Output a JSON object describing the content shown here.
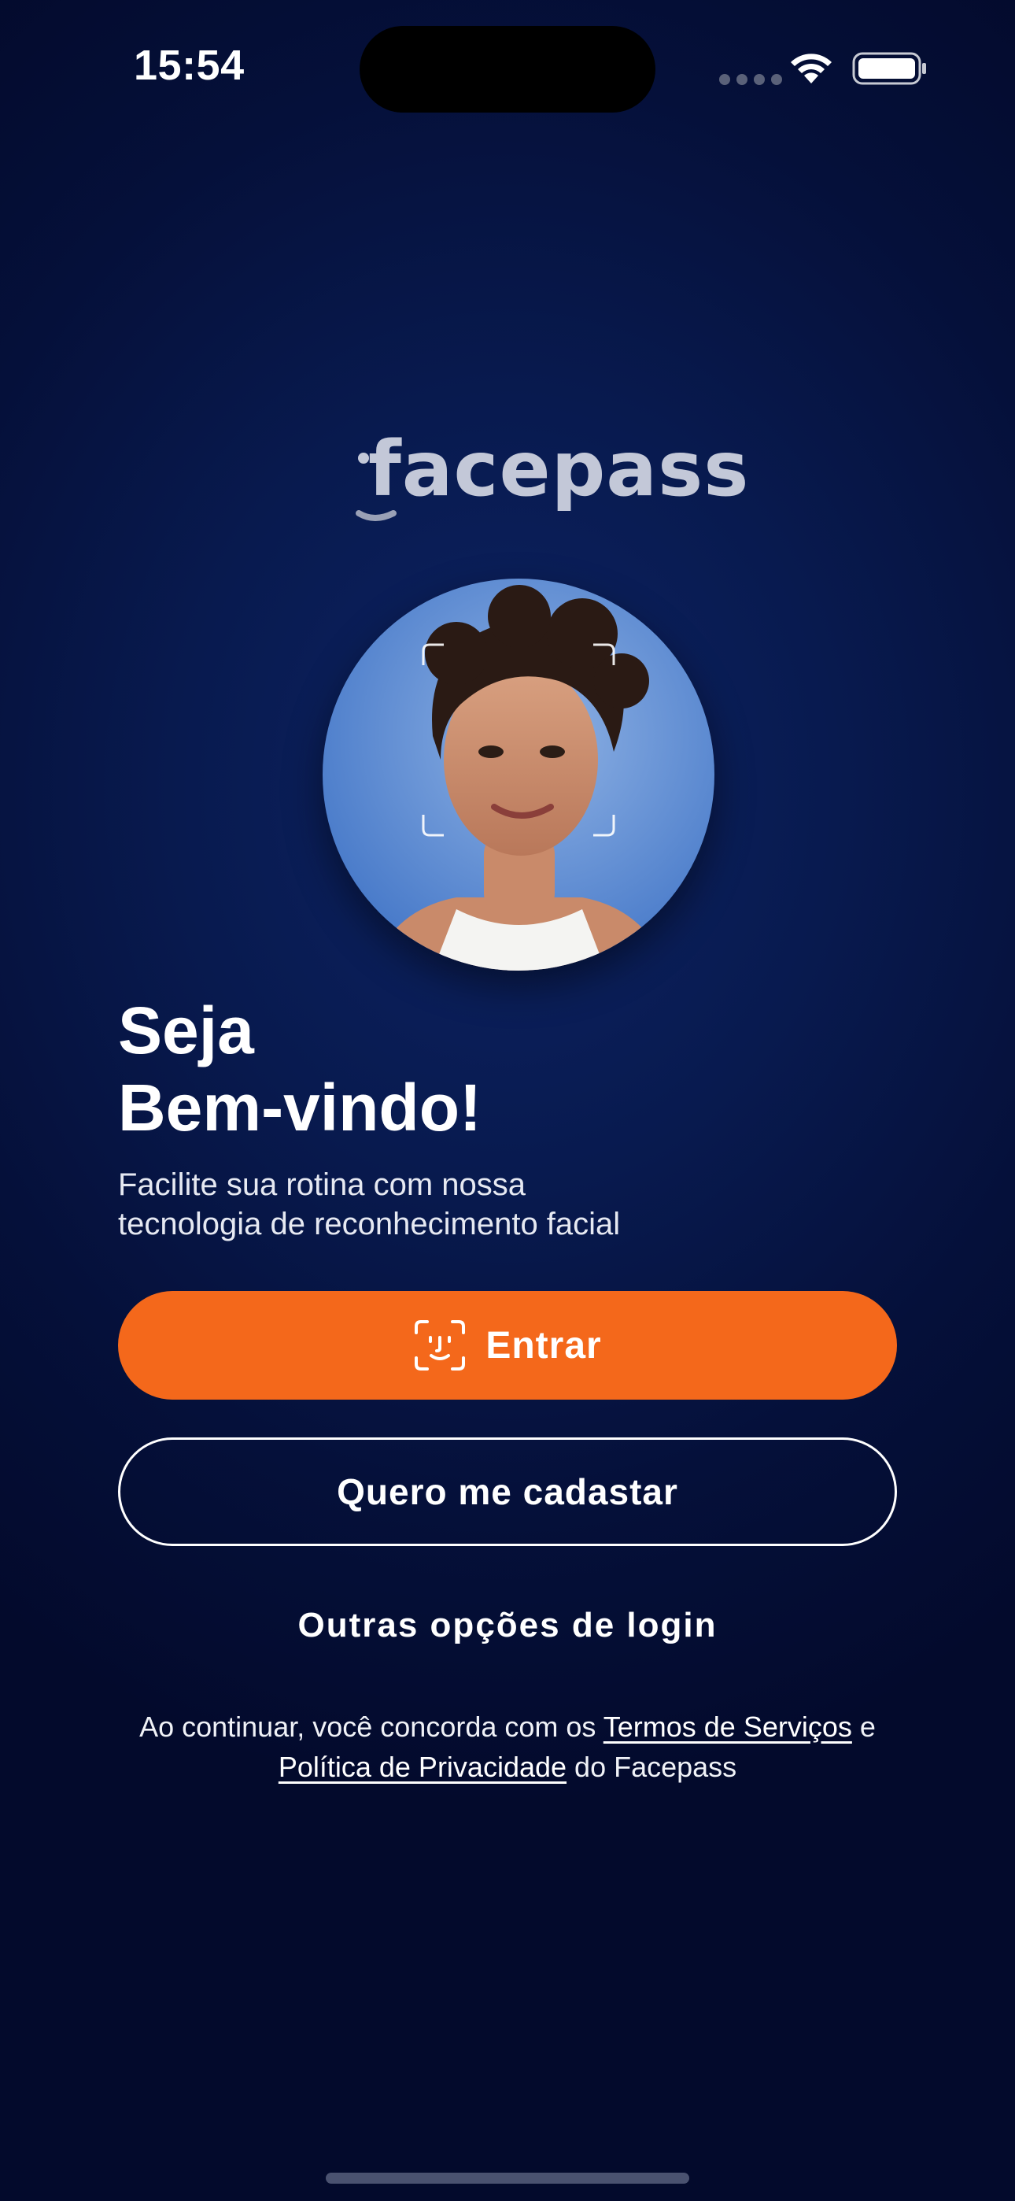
{
  "status_bar": {
    "time": "15:54"
  },
  "brand": {
    "logo_text": "facepass"
  },
  "welcome": {
    "title_line1": "Seja",
    "title_line2": "Bem-vindo!",
    "subtitle_line1": "Facilite sua rotina com nossa",
    "subtitle_line2": "tecnologia de reconhecimento facial"
  },
  "actions": {
    "login_label": "Entrar",
    "signup_label": "Quero me cadastar",
    "other_login_label": "Outras opções de login"
  },
  "legal": {
    "prefix": "Ao continuar, você concorda com os ",
    "terms_link": "Termos de Serviços",
    "middle": " e",
    "privacy_link": "Política de Privacidade",
    "suffix": " do Facepass"
  },
  "colors": {
    "accent": "#f4681b",
    "background": "#05103a"
  }
}
